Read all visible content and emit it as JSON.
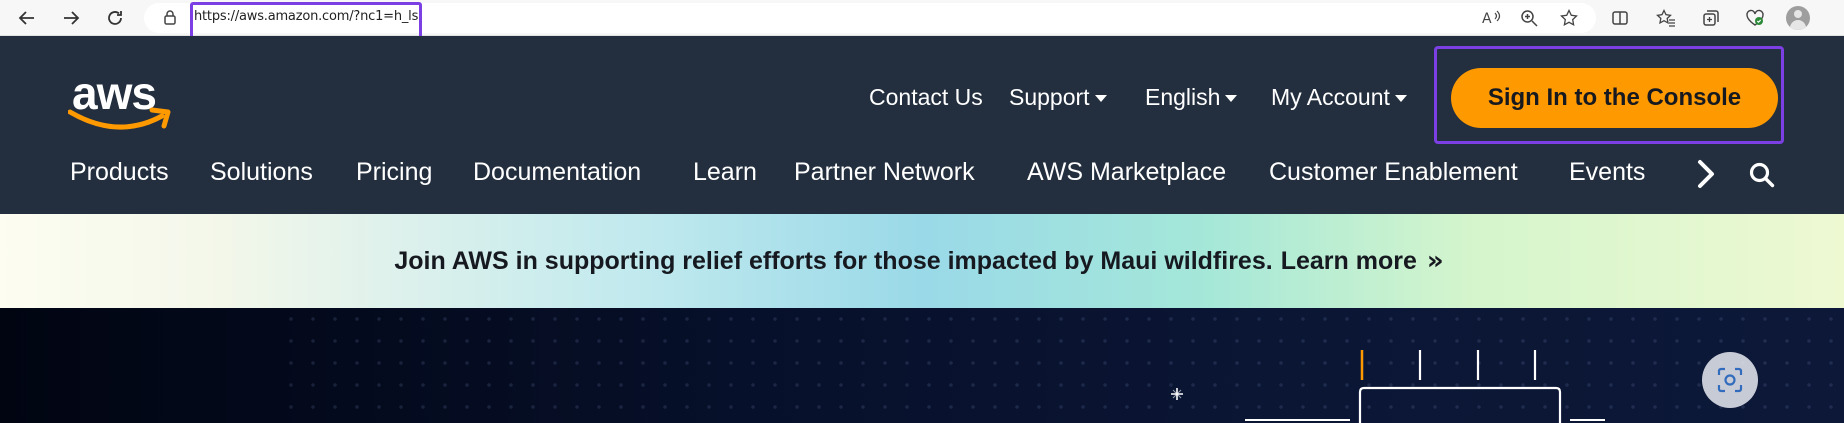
{
  "browser": {
    "url": "https://aws.amazon.com/?nc1=h_ls",
    "nav_buttons": [
      "back-icon",
      "forward-icon",
      "refresh-icon"
    ],
    "toolbar_icons": [
      "read-aloud-icon",
      "zoom-icon",
      "favorite-star-icon",
      "split-screen-icon",
      "favorites-icon",
      "collections-icon",
      "browser-essentials-icon",
      "profile-icon"
    ]
  },
  "header": {
    "logo_text": "aws",
    "top_links": {
      "contact": "Contact Us",
      "support": "Support",
      "language": "English",
      "account": "My Account"
    },
    "signin_label": "Sign In to the Console"
  },
  "nav": {
    "items": [
      "Products",
      "Solutions",
      "Pricing",
      "Documentation",
      "Learn",
      "Partner Network",
      "AWS Marketplace",
      "Customer Enablement",
      "Events"
    ],
    "next_arrow": "›"
  },
  "banner": {
    "text": "Join AWS in supporting relief efforts for those impacted by Maui wildfires.",
    "link": "Learn more",
    "arrow": "»"
  },
  "colors": {
    "header_bg": "#232f3e",
    "signin_bg": "#ff9900",
    "highlight": "#7b3fe4",
    "logo_smile": "#ff9900"
  }
}
